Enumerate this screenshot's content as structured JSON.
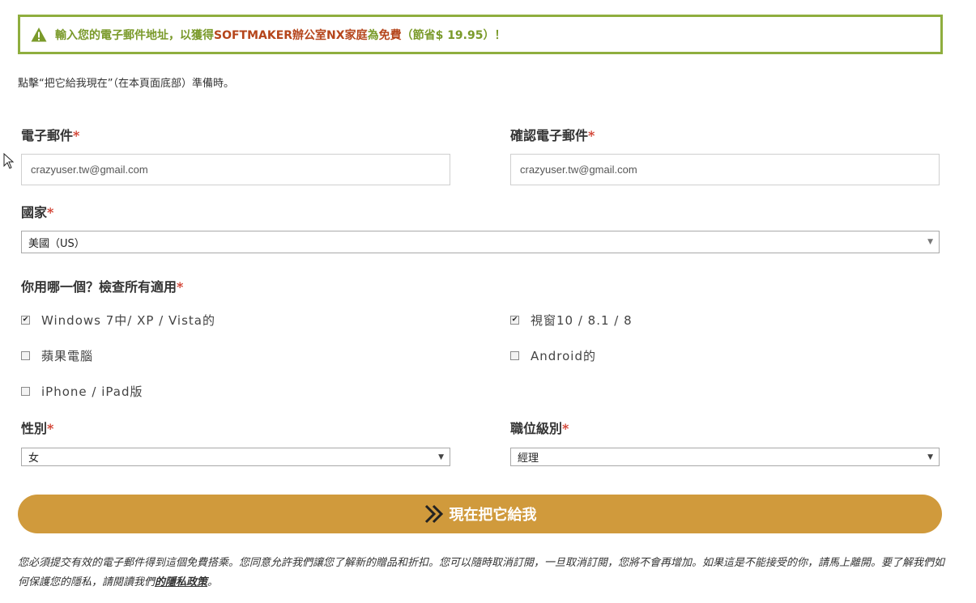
{
  "banner": {
    "icon": "warning-icon",
    "part1": "輸入您的電子郵件地址，以獲得",
    "product": "SOFTMAKER辦公室NX家庭",
    "part2": "為",
    "free": "免費",
    "part3": "（節省$ 19.95）！",
    "colors": {
      "border": "#8fae3e",
      "green": "#7a9a2a",
      "brown": "#b5451b"
    }
  },
  "intro": "點擊“把它給我現在”（在本頁面底部）準備時。",
  "form": {
    "required_mark": "*",
    "email": {
      "label": "電子郵件",
      "value": "crazyuser.tw@gmail.com"
    },
    "confirm_email": {
      "label": "確認電子郵件",
      "value": "crazyuser.tw@gmail.com"
    },
    "country": {
      "label": "國家",
      "value": "美國（US）"
    },
    "platforms": {
      "label": "你用哪一個？檢查所有適用",
      "options": [
        {
          "label": "Windows 7中/ XP / Vista的",
          "checked": true
        },
        {
          "label": "視窗10 / 8.1 / 8",
          "checked": true
        },
        {
          "label": "蘋果電腦",
          "checked": false
        },
        {
          "label": "Android的",
          "checked": false
        },
        {
          "label": "iPhone / iPad版",
          "checked": false
        }
      ]
    },
    "gender": {
      "label": "性別",
      "value": "女"
    },
    "job_level": {
      "label": "職位級別",
      "value": "經理"
    },
    "submit": {
      "label": "現在把它給我",
      "color": "#d09a3c"
    }
  },
  "footer": {
    "text": "您必須提交有效的電子郵件得到這個免費搭乘。您同意允許我們讓您了解新的贈品和折扣。您可以隨時取消訂閱，一旦取消訂閱，您將不會再增加。如果這是不能接受的你，請馬上離開。要了解我們如何保護您的隱私，請閱讀我們",
    "link": "的隱私政策",
    "end": "。"
  }
}
